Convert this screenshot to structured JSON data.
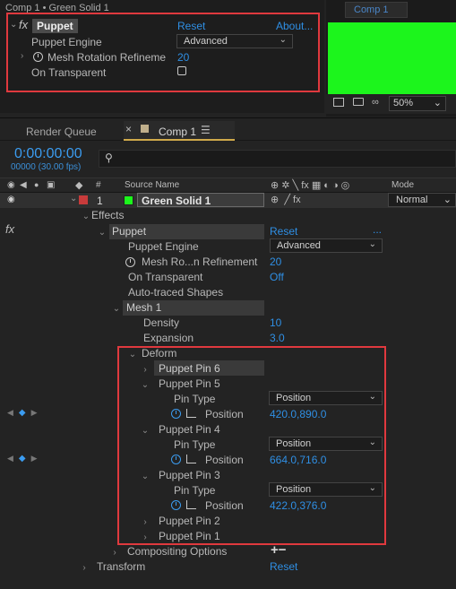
{
  "effect_controls": {
    "title": "Comp 1 • Green Solid 1",
    "fx_label": "fx",
    "effect_name": "Puppet",
    "reset": "Reset",
    "about": "About...",
    "rows": [
      {
        "label": "Puppet Engine",
        "value": "Advanced"
      },
      {
        "label": "Mesh Rotation Refineme",
        "value": "20"
      },
      {
        "label": "On Transparent",
        "value": ""
      }
    ]
  },
  "viewer": {
    "tab": "Comp 1",
    "zoom": "50%",
    "solid_color": "#1cf51c"
  },
  "timeline": {
    "tabs": [
      {
        "label": "Render Queue"
      },
      {
        "label": "Comp 1"
      }
    ],
    "close_glyph": "×",
    "menu_glyph": "☰",
    "timecode": "0:00:00:00",
    "fps": "00000 (30.00 fps)",
    "search_icon": "search-icon",
    "columns": {
      "hash": "#",
      "source_name": "Source Name",
      "mode": "Mode"
    },
    "layer": {
      "number": "1",
      "name": "Green Solid 1",
      "mode": "Normal",
      "label_color": "#c83b3b",
      "swatch_color": "#1cf51c"
    },
    "tree": {
      "effects": "Effects",
      "fx": "fx",
      "puppet": "Puppet",
      "reset": "Reset",
      "ellipsis": "...",
      "puppet_engine_label": "Puppet Engine",
      "puppet_engine_value": "Advanced",
      "mesh_rot_label": "Mesh Ro...n Refinement",
      "mesh_rot_value": "20",
      "on_transparent_label": "On Transparent",
      "on_transparent_value": "Off",
      "auto_traced": "Auto-traced Shapes",
      "mesh1": "Mesh 1",
      "density_label": "Density",
      "density_value": "10",
      "expansion_label": "Expansion",
      "expansion_value": "3.0",
      "deform": "Deform",
      "pin6": "Puppet Pin 6",
      "pin5": "Puppet Pin 5",
      "pin4": "Puppet Pin 4",
      "pin3": "Puppet Pin 3",
      "pin2": "Puppet Pin 2",
      "pin1": "Puppet Pin 1",
      "pin_type_label": "Pin Type",
      "pin_type_value": "Position",
      "position_label": "Position",
      "pin5_position": "420.0,890.0",
      "pin4_position": "664.0,716.0",
      "pin3_position": "422.0,376.0",
      "compositing": "Compositing Options",
      "plus_minus": "+−",
      "transform": "Transform",
      "transform_reset": "Reset"
    }
  }
}
